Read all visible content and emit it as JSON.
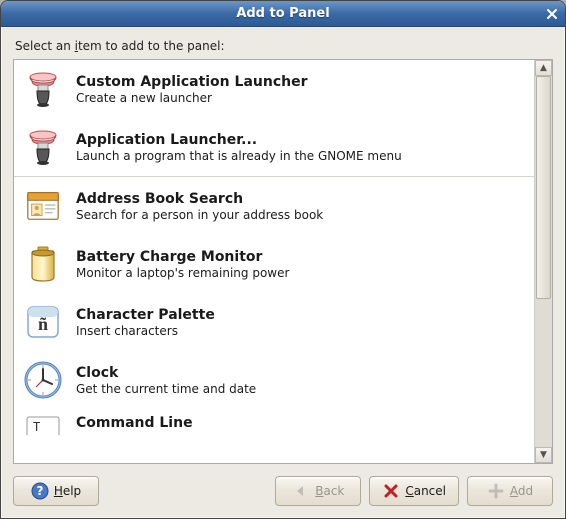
{
  "title": "Add to Panel",
  "prompt": "Select an item to add to the panel:",
  "items": [
    {
      "id": "custom-launcher",
      "title": "Custom Application Launcher",
      "desc": "Create a new launcher"
    },
    {
      "id": "app-launcher",
      "title": "Application Launcher...",
      "desc": "Launch a program that is already in the GNOME menu"
    },
    {
      "id": "address-book",
      "title": "Address Book Search",
      "desc": "Search for a person in your address book"
    },
    {
      "id": "battery",
      "title": "Battery Charge Monitor",
      "desc": "Monitor a laptop's remaining power"
    },
    {
      "id": "char-palette",
      "title": "Character Palette",
      "desc": "Insert characters"
    },
    {
      "id": "clock",
      "title": "Clock",
      "desc": "Get the current time and date"
    },
    {
      "id": "command-line",
      "title": "Command Line",
      "desc": ""
    }
  ],
  "buttons": {
    "help": "Help",
    "back": "Back",
    "cancel": "Cancel",
    "add": "Add"
  },
  "underlines": {
    "prompt_char": "i",
    "help": "H",
    "back": "B",
    "cancel": "C",
    "add": "A"
  },
  "state": {
    "back_enabled": false,
    "add_enabled": false
  }
}
